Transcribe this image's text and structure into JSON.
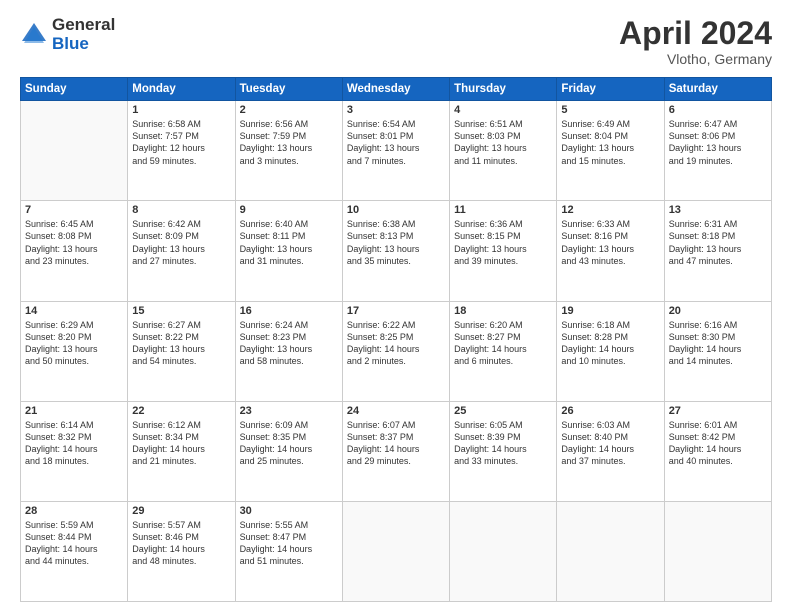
{
  "logo": {
    "general": "General",
    "blue": "Blue"
  },
  "header": {
    "month": "April 2024",
    "location": "Vlotho, Germany"
  },
  "weekdays": [
    "Sunday",
    "Monday",
    "Tuesday",
    "Wednesday",
    "Thursday",
    "Friday",
    "Saturday"
  ],
  "weeks": [
    [
      {
        "day": "",
        "info": ""
      },
      {
        "day": "1",
        "info": "Sunrise: 6:58 AM\nSunset: 7:57 PM\nDaylight: 12 hours\nand 59 minutes."
      },
      {
        "day": "2",
        "info": "Sunrise: 6:56 AM\nSunset: 7:59 PM\nDaylight: 13 hours\nand 3 minutes."
      },
      {
        "day": "3",
        "info": "Sunrise: 6:54 AM\nSunset: 8:01 PM\nDaylight: 13 hours\nand 7 minutes."
      },
      {
        "day": "4",
        "info": "Sunrise: 6:51 AM\nSunset: 8:03 PM\nDaylight: 13 hours\nand 11 minutes."
      },
      {
        "day": "5",
        "info": "Sunrise: 6:49 AM\nSunset: 8:04 PM\nDaylight: 13 hours\nand 15 minutes."
      },
      {
        "day": "6",
        "info": "Sunrise: 6:47 AM\nSunset: 8:06 PM\nDaylight: 13 hours\nand 19 minutes."
      }
    ],
    [
      {
        "day": "7",
        "info": "Sunrise: 6:45 AM\nSunset: 8:08 PM\nDaylight: 13 hours\nand 23 minutes."
      },
      {
        "day": "8",
        "info": "Sunrise: 6:42 AM\nSunset: 8:09 PM\nDaylight: 13 hours\nand 27 minutes."
      },
      {
        "day": "9",
        "info": "Sunrise: 6:40 AM\nSunset: 8:11 PM\nDaylight: 13 hours\nand 31 minutes."
      },
      {
        "day": "10",
        "info": "Sunrise: 6:38 AM\nSunset: 8:13 PM\nDaylight: 13 hours\nand 35 minutes."
      },
      {
        "day": "11",
        "info": "Sunrise: 6:36 AM\nSunset: 8:15 PM\nDaylight: 13 hours\nand 39 minutes."
      },
      {
        "day": "12",
        "info": "Sunrise: 6:33 AM\nSunset: 8:16 PM\nDaylight: 13 hours\nand 43 minutes."
      },
      {
        "day": "13",
        "info": "Sunrise: 6:31 AM\nSunset: 8:18 PM\nDaylight: 13 hours\nand 47 minutes."
      }
    ],
    [
      {
        "day": "14",
        "info": "Sunrise: 6:29 AM\nSunset: 8:20 PM\nDaylight: 13 hours\nand 50 minutes."
      },
      {
        "day": "15",
        "info": "Sunrise: 6:27 AM\nSunset: 8:22 PM\nDaylight: 13 hours\nand 54 minutes."
      },
      {
        "day": "16",
        "info": "Sunrise: 6:24 AM\nSunset: 8:23 PM\nDaylight: 13 hours\nand 58 minutes."
      },
      {
        "day": "17",
        "info": "Sunrise: 6:22 AM\nSunset: 8:25 PM\nDaylight: 14 hours\nand 2 minutes."
      },
      {
        "day": "18",
        "info": "Sunrise: 6:20 AM\nSunset: 8:27 PM\nDaylight: 14 hours\nand 6 minutes."
      },
      {
        "day": "19",
        "info": "Sunrise: 6:18 AM\nSunset: 8:28 PM\nDaylight: 14 hours\nand 10 minutes."
      },
      {
        "day": "20",
        "info": "Sunrise: 6:16 AM\nSunset: 8:30 PM\nDaylight: 14 hours\nand 14 minutes."
      }
    ],
    [
      {
        "day": "21",
        "info": "Sunrise: 6:14 AM\nSunset: 8:32 PM\nDaylight: 14 hours\nand 18 minutes."
      },
      {
        "day": "22",
        "info": "Sunrise: 6:12 AM\nSunset: 8:34 PM\nDaylight: 14 hours\nand 21 minutes."
      },
      {
        "day": "23",
        "info": "Sunrise: 6:09 AM\nSunset: 8:35 PM\nDaylight: 14 hours\nand 25 minutes."
      },
      {
        "day": "24",
        "info": "Sunrise: 6:07 AM\nSunset: 8:37 PM\nDaylight: 14 hours\nand 29 minutes."
      },
      {
        "day": "25",
        "info": "Sunrise: 6:05 AM\nSunset: 8:39 PM\nDaylight: 14 hours\nand 33 minutes."
      },
      {
        "day": "26",
        "info": "Sunrise: 6:03 AM\nSunset: 8:40 PM\nDaylight: 14 hours\nand 37 minutes."
      },
      {
        "day": "27",
        "info": "Sunrise: 6:01 AM\nSunset: 8:42 PM\nDaylight: 14 hours\nand 40 minutes."
      }
    ],
    [
      {
        "day": "28",
        "info": "Sunrise: 5:59 AM\nSunset: 8:44 PM\nDaylight: 14 hours\nand 44 minutes."
      },
      {
        "day": "29",
        "info": "Sunrise: 5:57 AM\nSunset: 8:46 PM\nDaylight: 14 hours\nand 48 minutes."
      },
      {
        "day": "30",
        "info": "Sunrise: 5:55 AM\nSunset: 8:47 PM\nDaylight: 14 hours\nand 51 minutes."
      },
      {
        "day": "",
        "info": ""
      },
      {
        "day": "",
        "info": ""
      },
      {
        "day": "",
        "info": ""
      },
      {
        "day": "",
        "info": ""
      }
    ]
  ]
}
